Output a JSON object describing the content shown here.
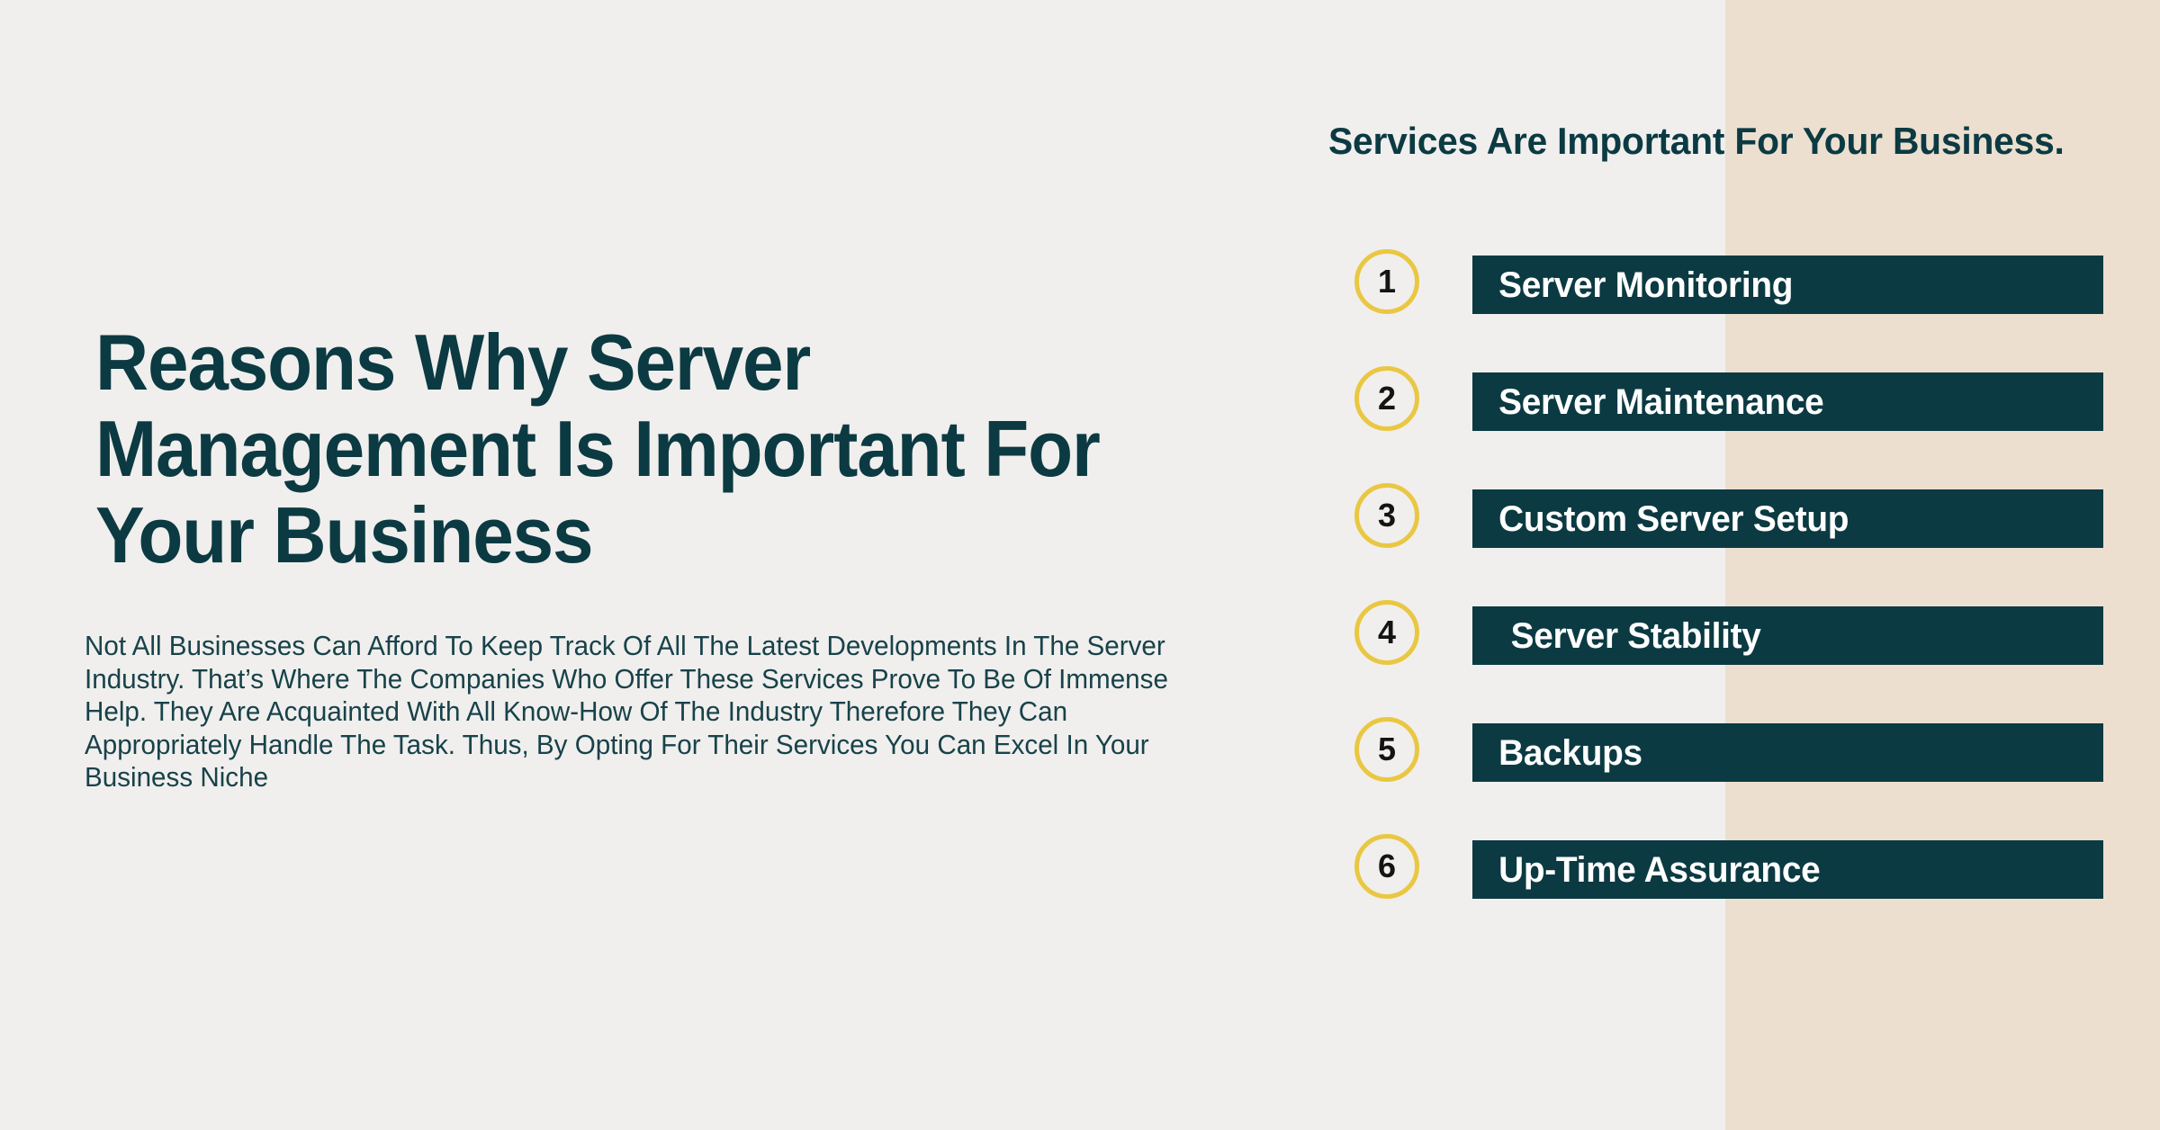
{
  "theme": {
    "background_left": "#f0efed",
    "background_right_panel": "#ecdfd0",
    "teal": "#0b3a42",
    "gold": "#eac743",
    "bar_text": "#ffffff",
    "number_text": "#141414"
  },
  "left": {
    "headline": "Reasons Why Server Management Is Important For Your Business",
    "paragraph": "Not All Businesses Can Afford To Keep Track Of All The Latest Developments In The Server Industry. That’s Where The Companies Who Offer These Services Prove To Be Of Immense Help. They Are Acquainted With All Know-How Of The Industry Therefore They Can Appropriately Handle The Task. Thus, By Opting For Their Services You Can Excel In Your Business Niche"
  },
  "right": {
    "heading": "Services Are Important For Your Business.",
    "services": [
      {
        "number": "1",
        "label": "Server Monitoring",
        "indented": false
      },
      {
        "number": "2",
        "label": "Server Maintenance",
        "indented": false
      },
      {
        "number": "3",
        "label": "Custom Server Setup",
        "indented": false
      },
      {
        "number": "4",
        "label": "Server Stability",
        "indented": true
      },
      {
        "number": "5",
        "label": "Backups",
        "indented": false
      },
      {
        "number": "6",
        "label": "Up-Time Assurance",
        "indented": false
      }
    ]
  }
}
